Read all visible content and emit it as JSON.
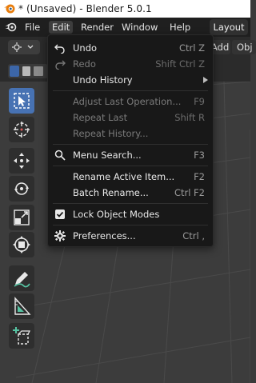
{
  "window": {
    "title": "* (Unsaved) - Blender 5.0.1"
  },
  "menubar": {
    "items": [
      "File",
      "Edit",
      "Render",
      "Window",
      "Help"
    ],
    "active": "Edit",
    "workspace_tab": "Layout"
  },
  "header": {
    "add_label": "Add",
    "object_label": "Obj"
  },
  "edit_menu": {
    "items": [
      {
        "label": "Undo",
        "shortcut": "Ctrl Z",
        "enabled": true,
        "icon": "undo-icon"
      },
      {
        "label": "Redo",
        "shortcut": "Shift Ctrl Z",
        "enabled": false,
        "icon": "redo-icon"
      },
      {
        "label": "Undo History",
        "shortcut": "",
        "enabled": true,
        "submenu": true
      },
      {
        "label": "Adjust Last Operation...",
        "shortcut": "F9",
        "enabled": false
      },
      {
        "label": "Repeat Last",
        "shortcut": "Shift R",
        "enabled": false
      },
      {
        "label": "Repeat History...",
        "shortcut": "",
        "enabled": false
      },
      {
        "label": "Menu Search...",
        "shortcut": "F3",
        "enabled": true,
        "icon": "search-icon"
      },
      {
        "label": "Rename Active Item...",
        "shortcut": "F2",
        "enabled": true
      },
      {
        "label": "Batch Rename...",
        "shortcut": "Ctrl F2",
        "enabled": true
      },
      {
        "label": "Lock Object Modes",
        "shortcut": "",
        "enabled": true,
        "checked": true,
        "icon": "checkbox-icon"
      },
      {
        "label": "Preferences...",
        "shortcut": "Ctrl ,",
        "enabled": true,
        "icon": "gear-icon"
      }
    ]
  },
  "toolbar": {
    "tools": [
      "select-box-icon",
      "cursor-icon",
      "move-icon",
      "rotate-icon",
      "scale-icon",
      "transform-icon",
      "annotate-icon",
      "measure-icon",
      "add-cube-icon"
    ],
    "active_tool": "select-box-icon"
  },
  "colors": {
    "accent": "#4772b3",
    "menu_bg": "#181818",
    "viewport_bg": "#3c3c3c"
  }
}
